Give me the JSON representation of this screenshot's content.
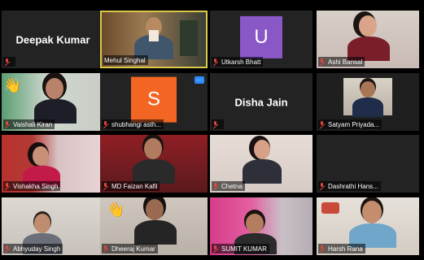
{
  "gallery": {
    "participants": [
      {
        "name": "Deepak Kumar",
        "display": "name",
        "label": ""
      },
      {
        "name": "Mehul Singhal",
        "display": "video",
        "label": "Mehul Singhal",
        "speaking": true
      },
      {
        "name": "Utkarsh Bhatt",
        "display": "avatar",
        "initial": "U",
        "avatar_color": "#8a57c7",
        "label": "Utkarsh Bhatt"
      },
      {
        "name": "Ashi Bansal",
        "display": "video",
        "label": "Ashi Bansal"
      },
      {
        "name": "Vaishali Kiran",
        "display": "video",
        "label": "Vaishali Kiran",
        "hand": true
      },
      {
        "name": "shubhangi asth...",
        "display": "avatar",
        "initial": "S",
        "avatar_color": "#f26522",
        "label": "shubhangi asth..."
      },
      {
        "name": "Disha Jain",
        "display": "name",
        "label": ""
      },
      {
        "name": "Satyam Priyada...",
        "display": "video",
        "label": "Satyam Priyada..."
      },
      {
        "name": "Vishakha Singh",
        "display": "video",
        "label": "Vishakha Singh"
      },
      {
        "name": "MD Faizan Kafil",
        "display": "video",
        "label": "MD Faizan Kafil"
      },
      {
        "name": "Chetna",
        "display": "video",
        "label": "Chetna"
      },
      {
        "name": "Dashrathi Hans...",
        "display": "blank",
        "label": "Dashrathi Hans..."
      },
      {
        "name": "Abhyuday Singh",
        "display": "video",
        "label": "Abhyuday Singh"
      },
      {
        "name": "Dheeraj Kumar",
        "display": "video",
        "label": "Dheeraj Kumar",
        "hand": true
      },
      {
        "name": "SUMIT KUMAR",
        "display": "video",
        "label": "SUMIT KUMAR"
      },
      {
        "name": "Harsh Rana",
        "display": "video",
        "label": "Harsh Rana"
      }
    ],
    "more_options": "..."
  },
  "colors": {
    "speaking_border": "#d9c84a",
    "muted_icon": "#e0463b",
    "tile_bg": "#232323"
  }
}
